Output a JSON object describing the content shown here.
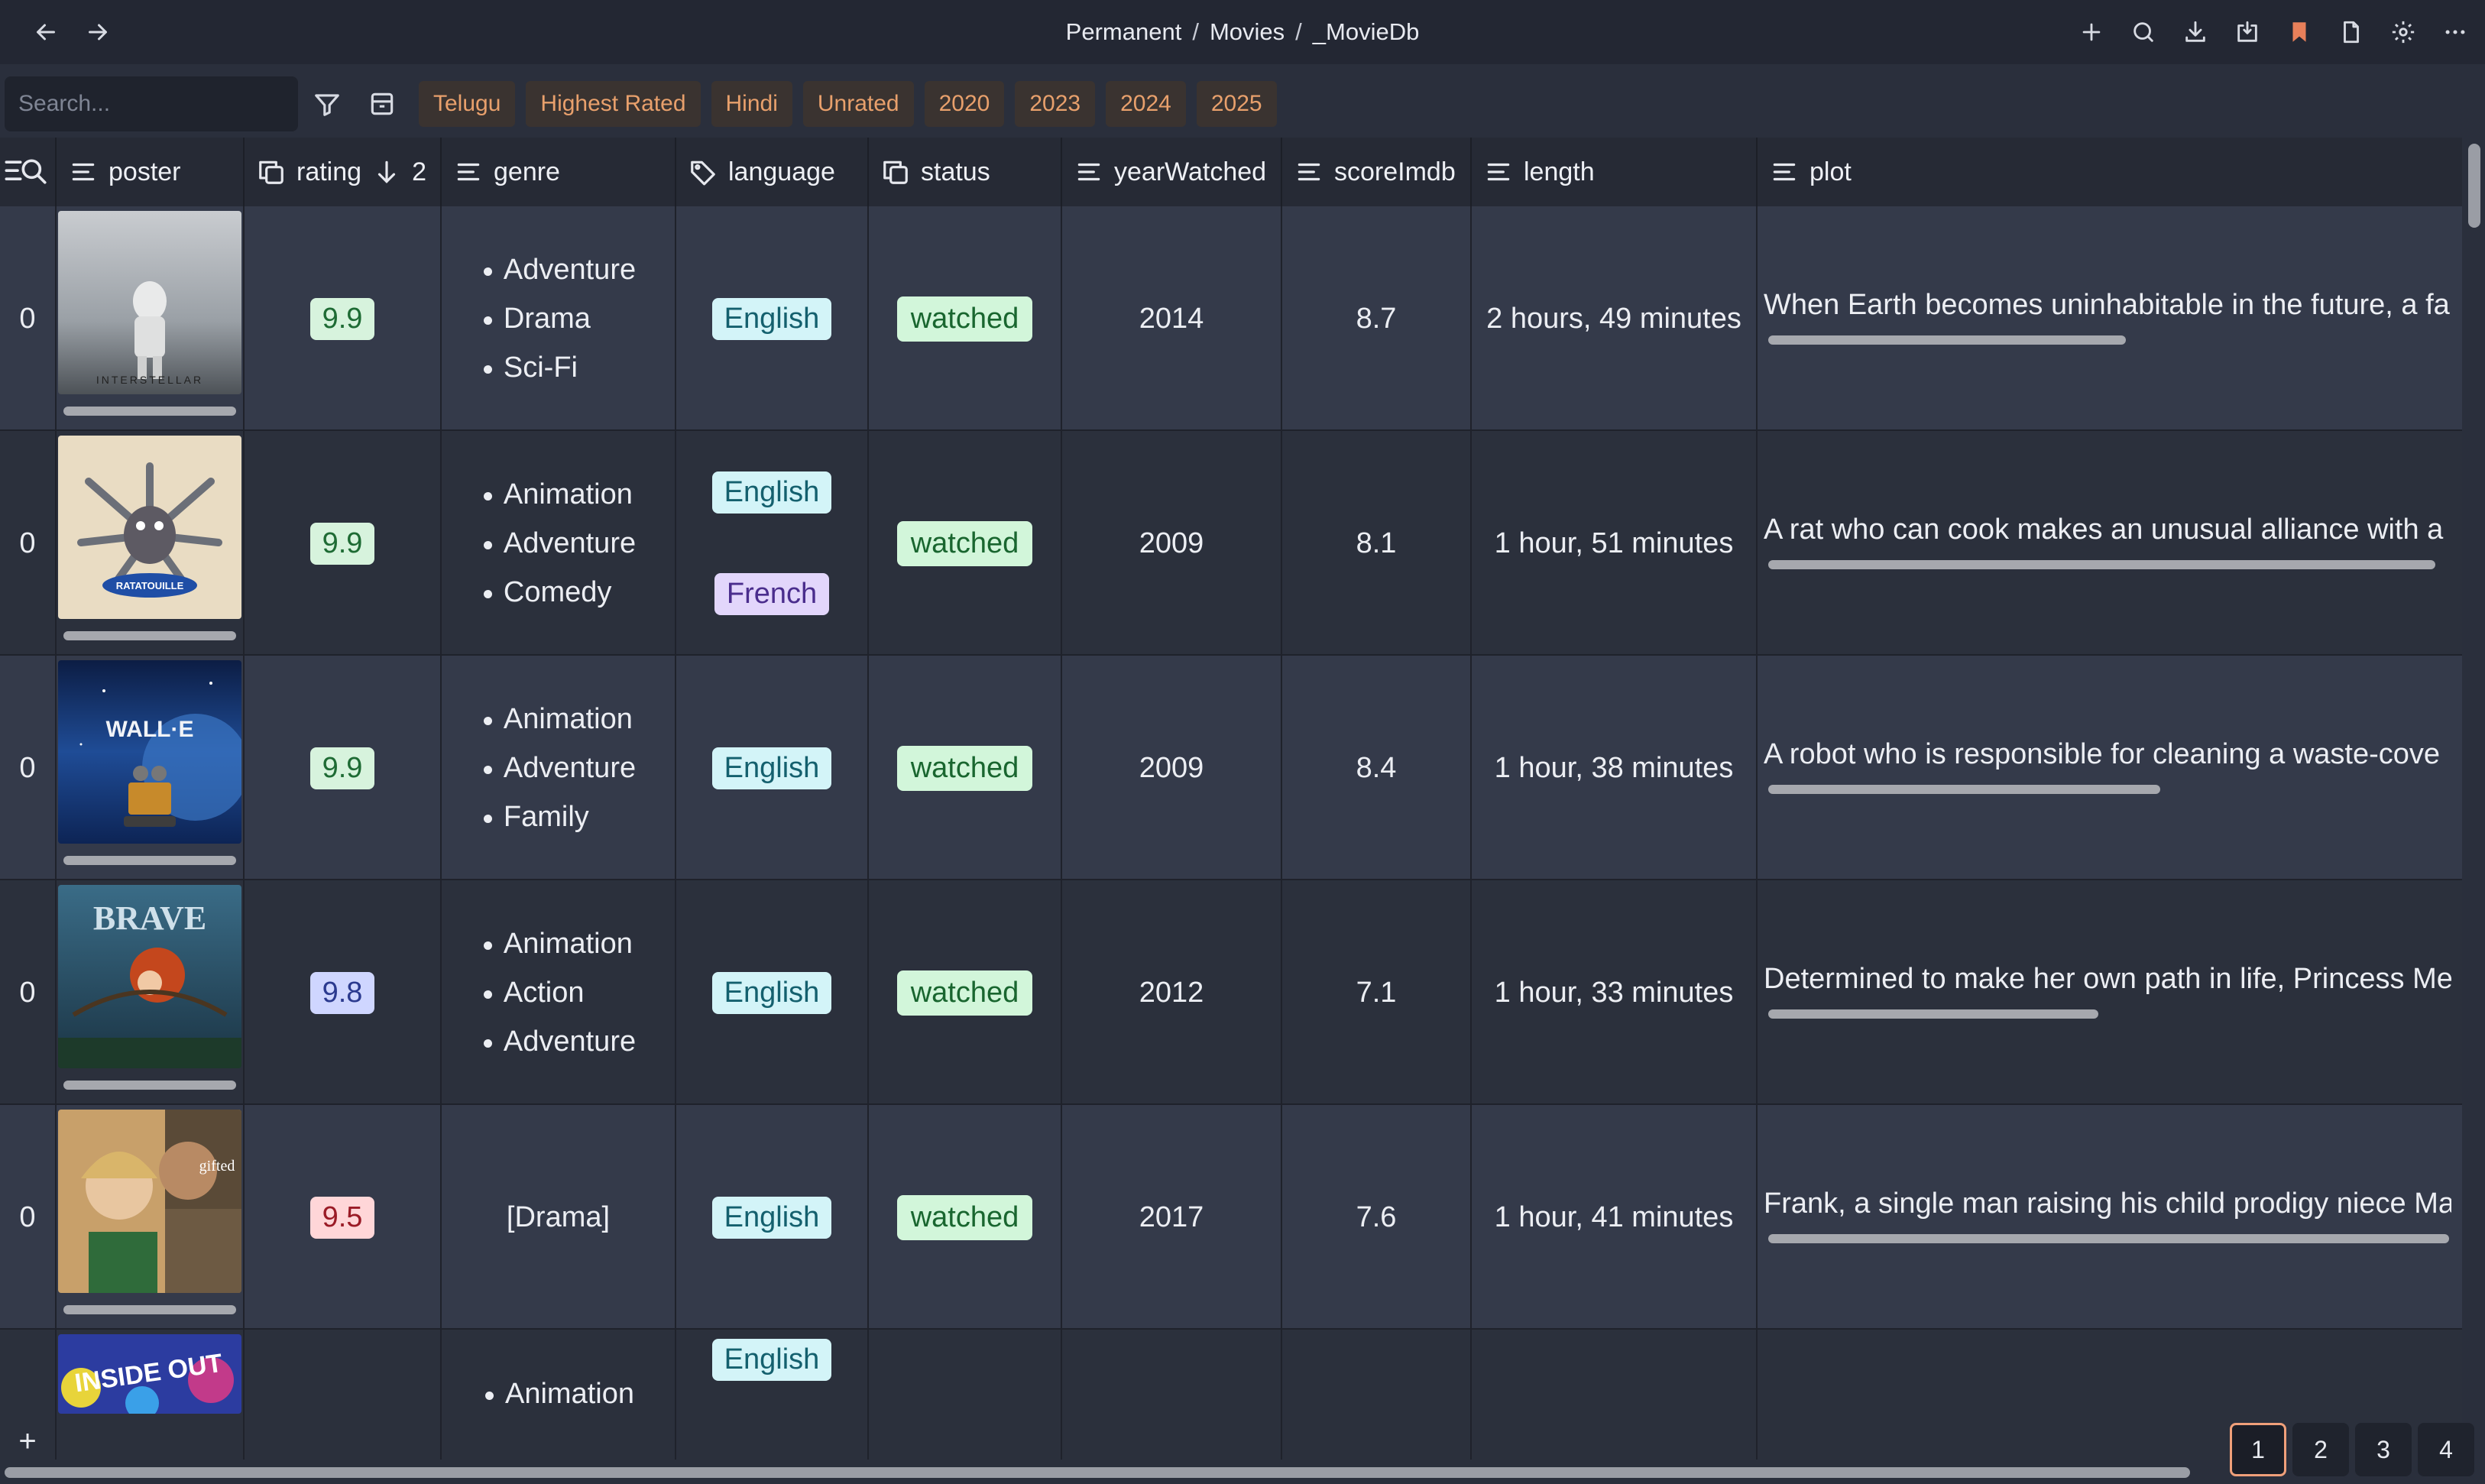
{
  "breadcrumb": [
    "Permanent",
    "Movies",
    "_MovieDb"
  ],
  "search": {
    "placeholder": "Search..."
  },
  "filters": [
    "Telugu",
    "Highest Rated",
    "Hindi",
    "Unrated",
    "2020",
    "2023",
    "2024",
    "2025"
  ],
  "columns": {
    "poster": "poster",
    "rating": "rating",
    "rating_sort_count": "2",
    "genre": "genre",
    "language": "language",
    "status": "status",
    "yearWatched": "yearWatched",
    "scoreImdb": "scoreImdb",
    "length": "length",
    "plot": "plot"
  },
  "rows": [
    {
      "index": "0",
      "poster": "Interstellar",
      "rating": "9.9",
      "rating_color": "green",
      "genres": [
        "Adventure",
        "Drama",
        "Sci-Fi"
      ],
      "languages": [
        "English"
      ],
      "status": "watched",
      "yearWatched": "2014",
      "scoreImdb": "8.7",
      "length": "2 hours, 49 minutes",
      "plot": "When Earth becomes uninhabitable in the future, a fa",
      "plot_scroll": 0.52
    },
    {
      "index": "0",
      "poster": "Ratatouille",
      "rating": "9.9",
      "rating_color": "green",
      "genres": [
        "Animation",
        "Adventure",
        "Comedy"
      ],
      "languages": [
        "English",
        "French"
      ],
      "status": "watched",
      "yearWatched": "2009",
      "scoreImdb": "8.1",
      "length": "1 hour, 51 minutes",
      "plot": "A rat who can cook makes an unusual alliance with a",
      "plot_scroll": 0.97
    },
    {
      "index": "0",
      "poster": "WALL-E",
      "rating": "9.9",
      "rating_color": "green",
      "genres": [
        "Animation",
        "Adventure",
        "Family"
      ],
      "languages": [
        "English"
      ],
      "status": "watched",
      "yearWatched": "2009",
      "scoreImdb": "8.4",
      "length": "1 hour, 38 minutes",
      "plot": "A robot who is responsible for cleaning a waste-cove",
      "plot_scroll": 0.57
    },
    {
      "index": "0",
      "poster": "Brave",
      "rating": "9.8",
      "rating_color": "blue",
      "genres": [
        "Animation",
        "Action",
        "Adventure"
      ],
      "languages": [
        "English"
      ],
      "status": "watched",
      "yearWatched": "2012",
      "scoreImdb": "7.1",
      "length": "1 hour, 33 minutes",
      "plot": "Determined to make her own path in life, Princess Me",
      "plot_scroll": 0.48
    },
    {
      "index": "0",
      "poster": "Gifted",
      "rating": "9.5",
      "rating_color": "red",
      "genres_text": "[Drama]",
      "languages": [
        "English"
      ],
      "status": "watched",
      "yearWatched": "2017",
      "scoreImdb": "7.6",
      "length": "1 hour, 41 minutes",
      "plot": "Frank, a single man raising his child prodigy niece Ma",
      "plot_scroll": 0.99
    },
    {
      "index": "",
      "poster": "Inside Out",
      "rating": "",
      "genres": [
        "Animation"
      ],
      "languages": [
        "English"
      ]
    }
  ],
  "poster_text": {
    "interstellar": "INTERSTELLAR",
    "ratatouille": "RATATOUILLE",
    "walle": "WALL·E",
    "brave": "BRAVE",
    "gifted": "gifted",
    "insideout": "INSIDE OUT"
  },
  "add_row": "+",
  "pagination": {
    "pages": [
      "1",
      "2",
      "3",
      "4"
    ],
    "current": "1"
  }
}
